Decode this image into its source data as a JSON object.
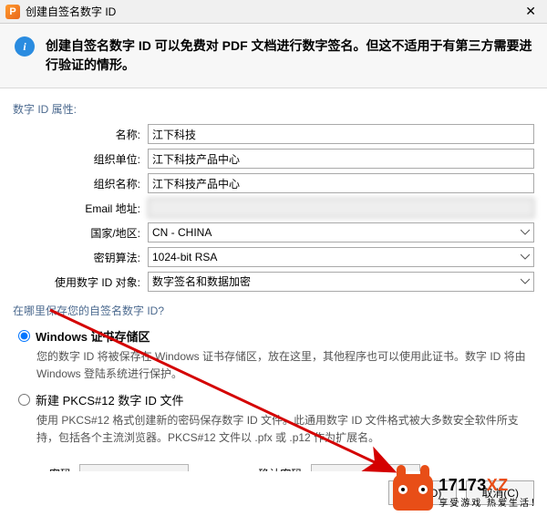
{
  "titlebar": {
    "title": "创建自签名数字 ID"
  },
  "banner": {
    "text": "创建自签名数字 ID 可以免费对 PDF 文档进行数字签名。但这不适用于有第三方需要进行验证的情形。"
  },
  "section1_label": "数字 ID 属性:",
  "fields": {
    "name_label": "名称:",
    "name_value": "江下科技",
    "org_unit_label": "组织单位:",
    "org_unit_value": "江下科技产品中心",
    "org_name_label": "组织名称:",
    "org_name_value": "江下科技产品中心",
    "email_label": "Email 地址:",
    "email_value": "",
    "country_label": "国家/地区:",
    "country_value": "CN - CHINA",
    "key_algo_label": "密钥算法:",
    "key_algo_value": "1024-bit RSA",
    "use_for_label": "使用数字 ID 对象:",
    "use_for_value": "数字签名和数据加密"
  },
  "section2_label": "在哪里保存您的自签名数字 ID?",
  "radio": {
    "win_title": "Windows 证书存储区",
    "win_desc": "您的数字 ID 将被保存在 Windows 证书存储区，放在这里，其他程序也可以使用此证书。数字 ID 将由 Windows 登陆系统进行保护。",
    "pkcs_title": "新建 PKCS#12 数字 ID 文件",
    "pkcs_desc": "使用 PKCS#12 格式创建新的密码保存数字 ID 文件。此通用数字 ID 文件格式被大多数安全软件所支持，包括各个主流浏览器。PKCS#12 文件以 .pfx 或 .p12 作为扩展名。"
  },
  "password": {
    "pw_label": "密码:",
    "confirm_label": "确认密码:"
  },
  "buttons": {
    "ok": "确定(O)",
    "cancel": "取消(C)"
  },
  "watermark": {
    "title1": "17173",
    "title2": "XZ",
    "sub": "享受游戏  热爱生活！"
  }
}
